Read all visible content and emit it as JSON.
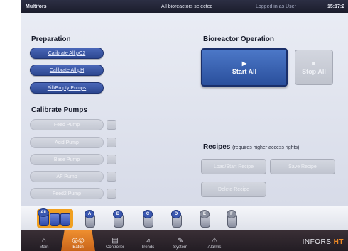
{
  "titlebar": {
    "app": "Multifors",
    "selection": "All bioreactors selected",
    "login": "Logged in as User",
    "time": "15:17:2"
  },
  "preparation": {
    "title": "Preparation",
    "buttons": [
      "Calibrate All pO2",
      "Calibrate All pH",
      "Fill/Empty Pumps"
    ]
  },
  "calibrate_pumps": {
    "title": "Calibrate Pumps",
    "buttons": [
      "Feed Pump",
      "Acid Pump",
      "Base Pump",
      "AF Pump",
      "Feed2 Pump"
    ]
  },
  "bioreactor_operation": {
    "title": "Bioreactor Operation",
    "start": "Start All",
    "stop": "Stop All",
    "start_glyph": "play-icon",
    "stop_glyph": "stop-icon"
  },
  "recipes": {
    "title": "Recipes",
    "note": "(requires higher access rights)",
    "load_start": "Load/Start Recipe",
    "save": "Save Recipe",
    "delete": "Delete Recipe"
  },
  "reactors": [
    {
      "label": "All",
      "selected": true
    },
    {
      "label": "A",
      "selected": false
    },
    {
      "label": "B",
      "selected": false
    },
    {
      "label": "C",
      "selected": false
    },
    {
      "label": "D",
      "selected": false
    },
    {
      "label": "E",
      "selected": false
    },
    {
      "label": "F",
      "selected": false
    }
  ],
  "nav": {
    "tabs": [
      {
        "label": "Main",
        "icon": "home-icon",
        "glyph": "⌂"
      },
      {
        "label": "Batch",
        "icon": "batch-icon",
        "glyph": "◎◎"
      },
      {
        "label": "Controller",
        "icon": "controller-icon",
        "glyph": "▤"
      },
      {
        "label": "Trends",
        "icon": "trends-icon",
        "glyph": "⩘"
      },
      {
        "label": "System",
        "icon": "system-icon",
        "glyph": "✎"
      },
      {
        "label": "Alarms",
        "icon": "alarm-icon",
        "glyph": "⚠"
      }
    ],
    "active_tab": "Batch",
    "brand_a": "INFORS",
    "brand_b": "HT"
  },
  "colors": {
    "accent": "#f09030",
    "primary_button": "#2f4fa0",
    "panel": "#e2e5ee"
  }
}
